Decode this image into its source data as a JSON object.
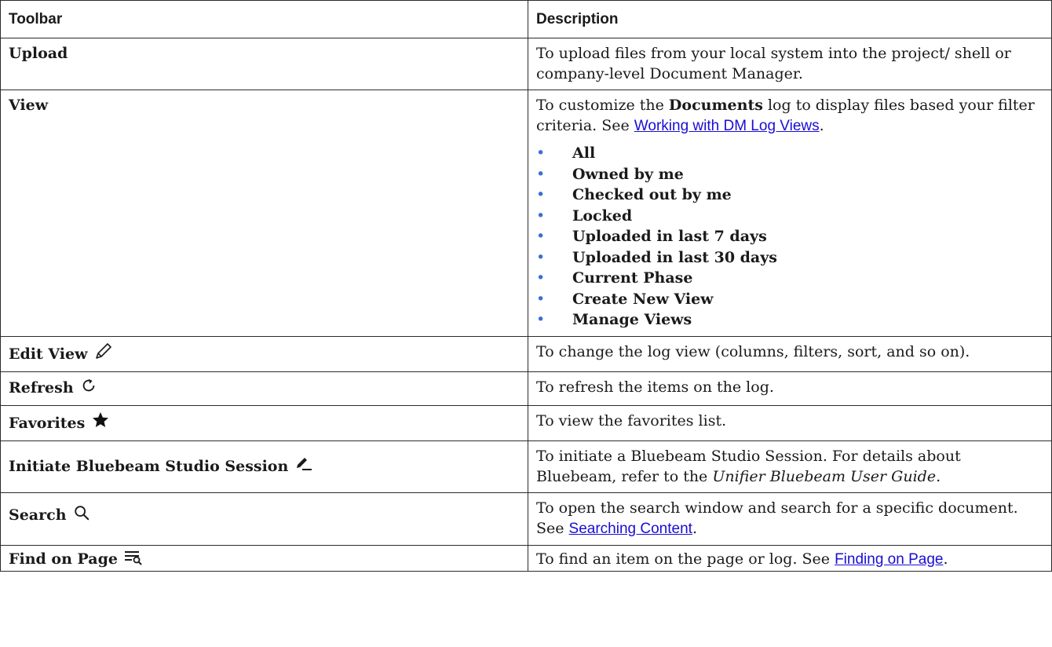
{
  "header": {
    "col1": "Toolbar",
    "col2": "Description"
  },
  "rows": {
    "upload": {
      "tool": "Upload",
      "desc": "To upload files from your local system into the project/ shell or company-level Document Manager."
    },
    "view": {
      "tool": "View",
      "desc_pre": "To customize the ",
      "desc_bold": "Documents",
      "desc_mid": " log to display files based your filter criteria. See ",
      "link": "Working with DM Log Views",
      "desc_post": ".",
      "options": [
        "All",
        "Owned by me",
        "Checked out by me",
        "Locked",
        "Uploaded in last 7 days",
        "Uploaded in last 30 days",
        "Current Phase",
        "Create New View",
        "Manage Views"
      ]
    },
    "edit_view": {
      "tool": "Edit View",
      "icon": "pencil-icon",
      "desc": "To change the log view (columns, filters, sort, and so on)."
    },
    "refresh": {
      "tool": "Refresh",
      "icon": "refresh-icon",
      "desc": "To refresh the items on the log."
    },
    "favorites": {
      "tool": "Favorites",
      "icon": "star-icon",
      "desc": "To view the favorites list."
    },
    "bluebeam": {
      "tool": "Initiate Bluebeam Studio Session",
      "icon": "pen-line-icon",
      "desc_pre": "To initiate a Bluebeam Studio Session. For details about Bluebeam, refer to the ",
      "desc_italic": "Unifier Bluebeam User Guide",
      "desc_post": "."
    },
    "search": {
      "tool": "Search",
      "icon": "search-icon",
      "desc_pre": "To open the search window and search for a specific document. See ",
      "link": "Searching Content",
      "desc_post": "."
    },
    "find": {
      "tool": "Find on Page",
      "icon": "find-list-icon",
      "desc_pre": "To find an item on the page or log. See ",
      "link": "Finding on Page",
      "desc_post": "."
    }
  },
  "colors": {
    "link": "#1a0dd4",
    "bullet": "#3b6fd4",
    "border": "#2b2b2b"
  }
}
